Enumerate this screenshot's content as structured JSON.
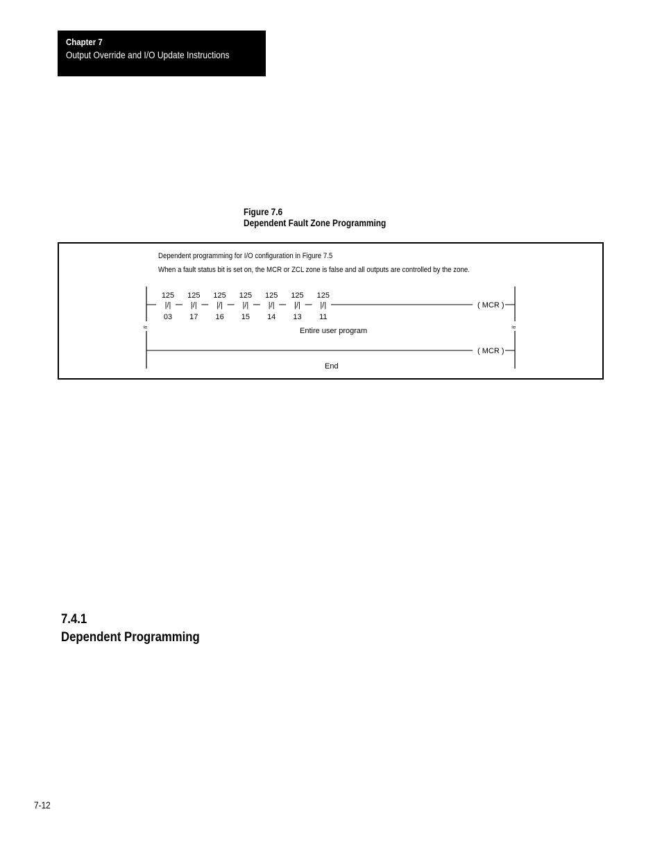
{
  "header": {
    "chapter_label": "Chapter 7",
    "chapter_title": "Output Override and I/O Update Instructions"
  },
  "figure": {
    "number": "Figure 7.6",
    "title": "Dependent Fault Zone Programming",
    "notes": [
      "Dependent programming for I/O configuration in Figure 7.5",
      "When a fault status bit is set on, the MCR or ZCL zone is false and all outputs are controlled by the zone."
    ],
    "rung1": {
      "contacts": [
        {
          "word": "125",
          "symbol": "|/|",
          "bit": "03"
        },
        {
          "word": "125",
          "symbol": "|/|",
          "bit": "17"
        },
        {
          "word": "125",
          "symbol": "|/|",
          "bit": "16"
        },
        {
          "word": "125",
          "symbol": "|/|",
          "bit": "15"
        },
        {
          "word": "125",
          "symbol": "|/|",
          "bit": "14"
        },
        {
          "word": "125",
          "symbol": "|/|",
          "bit": "13"
        },
        {
          "word": "125",
          "symbol": "|/|",
          "bit": "11"
        }
      ],
      "output": "( MCR )"
    },
    "middle_label": "Entire user program",
    "break_symbol": "≈",
    "rung2": {
      "output": "( MCR )"
    },
    "end_label": "End"
  },
  "section": {
    "number": "7.4.1",
    "title": "Dependent Programming"
  },
  "footer": {
    "page_number": "7-12"
  }
}
